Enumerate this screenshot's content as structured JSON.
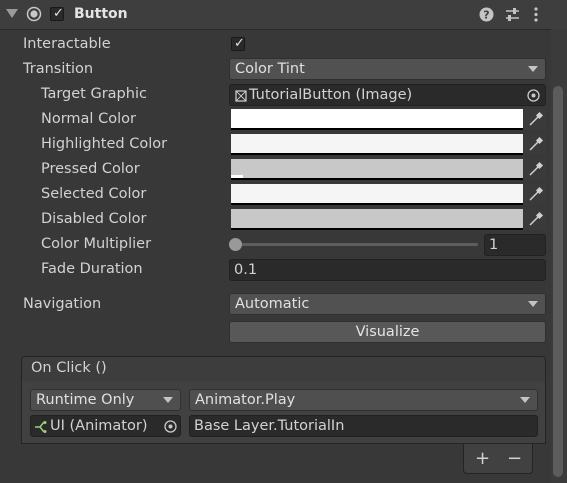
{
  "component": {
    "title": "Button",
    "enabled": true
  },
  "fields": {
    "interactable": {
      "label": "Interactable",
      "checked": true
    },
    "transition": {
      "label": "Transition",
      "value": "Color Tint"
    },
    "target_graphic": {
      "label": "Target Graphic",
      "value": "TutorialButton (Image)"
    },
    "normal_color": {
      "label": "Normal Color",
      "color": "#ffffff"
    },
    "highlighted_color": {
      "label": "Highlighted Color",
      "color": "#f5f5f5"
    },
    "pressed_color": {
      "label": "Pressed Color",
      "color": "#c8c8c8"
    },
    "selected_color": {
      "label": "Selected Color",
      "color": "#f5f5f5"
    },
    "disabled_color": {
      "label": "Disabled Color",
      "color": "#c8c8c8"
    },
    "color_multiplier": {
      "label": "Color Multiplier",
      "value": "1",
      "slider_fraction": 0.0
    },
    "fade_duration": {
      "label": "Fade Duration",
      "value": "0.1"
    },
    "navigation": {
      "label": "Navigation",
      "value": "Automatic"
    },
    "visualize": {
      "label": "Visualize"
    }
  },
  "onclick": {
    "header": "On Click ()",
    "runtime": "Runtime Only",
    "function": "Animator.Play",
    "target_object": "UI (Animator)",
    "argument": "Base Layer.TutorialIn",
    "add_label": "+",
    "remove_label": "−"
  },
  "colors": {
    "panel_bg": "#383838",
    "field_bg": "#2a2a2a",
    "dropdown_bg": "#515151",
    "button_bg": "#585858"
  },
  "icons": {
    "foldout": "foldout-arrow-icon",
    "component": "component-icon",
    "help": "help-icon",
    "preset": "preset-icon",
    "menu": "kebab-menu-icon",
    "eyedropper": "eyedropper-icon",
    "object_picker": "object-picker-icon",
    "image": "image-icon",
    "animator": "animator-icon"
  }
}
